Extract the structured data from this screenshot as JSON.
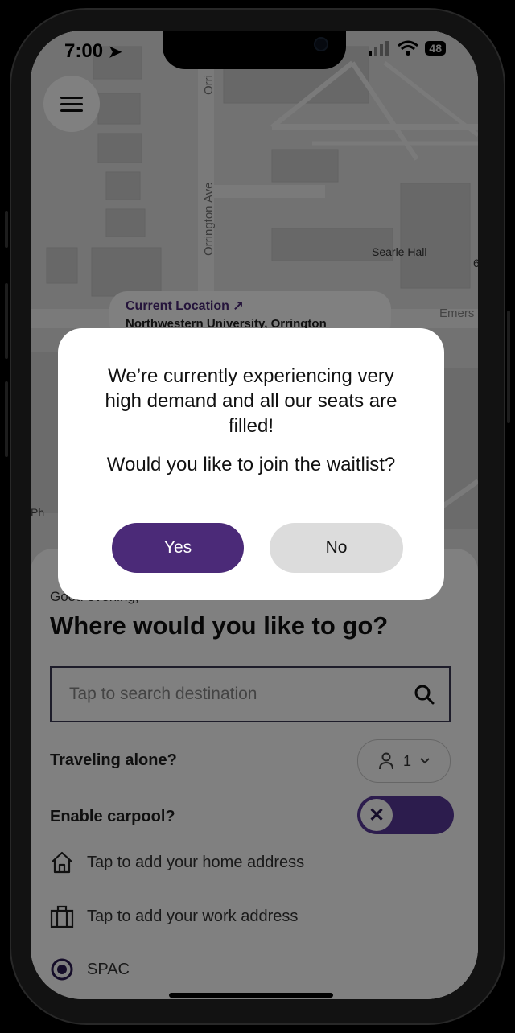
{
  "status": {
    "time": "7:00",
    "battery": "48"
  },
  "map": {
    "street_label": "Orrington Ave",
    "street_label_top": "Orri",
    "building_label": "Searle Hall",
    "edge_label": "Emers",
    "edge_label_left": "Ph",
    "edge_number": "6",
    "current_location_title": "Current Location",
    "current_location_subtitle": "Northwestern University, Orrington"
  },
  "sheet": {
    "greeting": "Good evening,",
    "heading": "Where would you like to go?",
    "search_placeholder": "Tap to search destination",
    "traveling_label": "Traveling alone?",
    "passenger_count": "1",
    "carpool_label": "Enable carpool?",
    "shortcuts": [
      {
        "icon": "home-icon",
        "label": "Tap to add your home address"
      },
      {
        "icon": "briefcase-icon",
        "label": "Tap to add your work address"
      },
      {
        "icon": "target-icon",
        "label": "SPAC"
      }
    ]
  },
  "dialog": {
    "message": "We’re currently experiencing very high demand and all our seats are filled!",
    "question": "Would you like to join the waitlist?",
    "yes_label": "Yes",
    "no_label": "No"
  },
  "colors": {
    "brand": "#4b2a78",
    "toggle": "#5a3a9a",
    "no_button": "#dcdcdc"
  }
}
